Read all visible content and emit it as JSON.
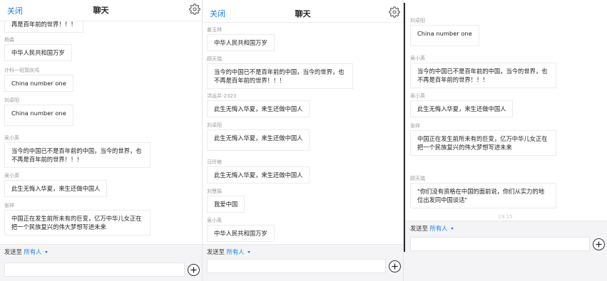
{
  "panels": [
    {
      "close": "关闭",
      "title": "聊天",
      "messages": [
        {
          "sender": "",
          "text": "再是百年前的世界！！！"
        },
        {
          "sender": "杨森",
          "text": "中华人民共和国万岁"
        },
        {
          "sender": "计科一班郭庆鸿",
          "text": "China number one"
        },
        {
          "sender": "刘卓阳",
          "text": "China number one"
        },
        {
          "sender": "吴小英",
          "text": "当今的中国已不是百年前的中国，当今的世界，也不再是百年前的世界！！！"
        },
        {
          "sender": "吴小英",
          "text": "此生无悔入华夏，来生还做中国人"
        },
        {
          "sender": "张祥",
          "text": "中国正在发生前所未有的巨变，亿万中华儿女正在把一个民族复兴的伟大梦想写进未来"
        }
      ],
      "footer": {
        "send_to": "发送至",
        "target": "所有人"
      }
    },
    {
      "close": "关闭",
      "title": "聊天",
      "messages": [
        {
          "sender": "姜玉林",
          "text": "中华人民共和国万岁"
        },
        {
          "sender": "顾天瑞",
          "text": "当今的中国已不是百年前的中国，当今的世界，也不再是百年前的世界！！！"
        },
        {
          "sender": "洪运并-2323",
          "text": "此生无悔入华夏，来生还做中国人"
        },
        {
          "sender": "刘卓阳",
          "text": "此生无悔入华夏，来生还做中国人"
        },
        {
          "sender": "马玲艳",
          "text": "此生无悔入华夏，来生还做中国人"
        },
        {
          "sender": "刘慧娟",
          "text": "我爱中国"
        },
        {
          "sender": "吴小英",
          "text": "中华人民共和国万岁"
        }
      ],
      "footer": {
        "send_to": "发送至",
        "target": "所有人"
      }
    },
    {
      "messages": [
        {
          "sender": "刘卓阳",
          "text": "China number one"
        },
        {
          "sender": "吴小英",
          "text": "当今的中国已不是百年前的中国，当今的世界，也不再是百年前的世界！！！"
        },
        {
          "sender": "吴小英",
          "text": "此生无悔入华夏，来生还做中国人"
        },
        {
          "sender": "张祥",
          "text": "中国正在发生前所未有的巨变，亿万中华儿女正在把一个民族复兴的伟大梦想写进未来"
        },
        {
          "sender": "顾天瑞",
          "text": "\"你们没有资格在中国的面前说，你们从实力的地位出发同中国谈话\""
        }
      ],
      "timestamp": "19:15",
      "footer": {
        "send_to": "发送至",
        "target": "所有人"
      }
    }
  ],
  "icons": {
    "settings": "gear-icon",
    "add": "plus-circle-icon",
    "dropdown": "caret-down-icon"
  },
  "colors": {
    "accent": "#1c7fe2",
    "bubble_border": "#ececec",
    "footer_bg": "#f4f4f6",
    "sender_text": "#999999"
  }
}
